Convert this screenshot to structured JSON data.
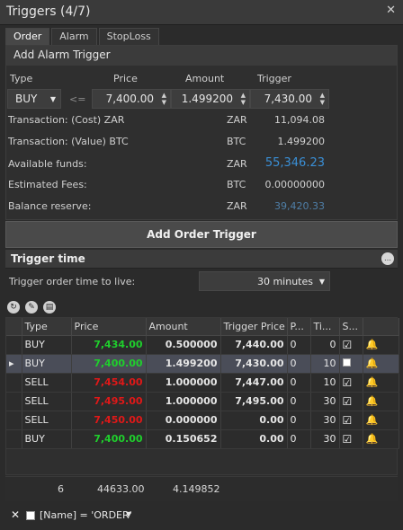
{
  "window": {
    "title": "Triggers (4/7)",
    "close_glyph": "✕"
  },
  "tabs": [
    {
      "label": "Order",
      "active": true
    },
    {
      "label": "Alarm",
      "active": false
    },
    {
      "label": "StopLoss",
      "active": false
    }
  ],
  "form": {
    "header": "Add Alarm Trigger",
    "labels": {
      "type": "Type",
      "price": "Price",
      "amount": "Amount",
      "trigger": "Trigger"
    },
    "type_value": "BUY",
    "operator": "<=",
    "price_value": "7,400.00",
    "amount_value": "1.499200",
    "trigger_value": "7,430.00",
    "rows": [
      {
        "label": "Transaction: (Cost) ZAR",
        "currency": "ZAR",
        "value": "11,094.08"
      },
      {
        "label": "Transaction: (Value) BTC",
        "currency": "BTC",
        "value": "1.499200"
      },
      {
        "label": "Available funds:",
        "currency": "ZAR",
        "value": "55,346.23"
      },
      {
        "label": "Estimated Fees:",
        "currency": "BTC",
        "value": "0.00000000"
      },
      {
        "label": "Balance reserve:",
        "currency": "ZAR",
        "value": "39,420.33"
      }
    ]
  },
  "add_button": "Add Order Trigger",
  "trigger_time": {
    "title": "Trigger time",
    "ttl_label": "Trigger order time to live:",
    "ttl_value": "30 minutes"
  },
  "grid": {
    "columns": [
      "Type",
      "Price",
      "Amount",
      "Trigger Price",
      "P...",
      "Ti...",
      "S..."
    ],
    "rows": [
      {
        "type": "BUY",
        "price": "7,434.00",
        "price_color": "green",
        "amount": "0.500000",
        "trigger": "7,440.00",
        "p": "0",
        "ti": "0",
        "checked": true,
        "bell": "green"
      },
      {
        "type": "BUY",
        "price": "7,400.00",
        "price_color": "green",
        "amount": "1.499200",
        "trigger": "7,430.00",
        "p": "0",
        "ti": "10",
        "checked": false,
        "bell": "blue",
        "selected": true
      },
      {
        "type": "SELL",
        "price": "7,454.00",
        "price_color": "red",
        "amount": "1.000000",
        "trigger": "7,447.00",
        "p": "0",
        "ti": "10",
        "checked": true,
        "bell": "red"
      },
      {
        "type": "SELL",
        "price": "7,495.00",
        "price_color": "red",
        "amount": "1.000000",
        "trigger": "7,495.00",
        "p": "0",
        "ti": "30",
        "checked": true,
        "bell": "red"
      },
      {
        "type": "SELL",
        "price": "7,450.00",
        "price_color": "red",
        "amount": "0.000000",
        "trigger": "0.00",
        "p": "0",
        "ti": "30",
        "checked": true,
        "bell": "yellow"
      },
      {
        "type": "BUY",
        "price": "7,400.00",
        "price_color": "green",
        "amount": "0.150652",
        "trigger": "0.00",
        "p": "0",
        "ti": "30",
        "checked": true,
        "bell": "yellow"
      }
    ]
  },
  "totals": {
    "count": "6",
    "price_sum": "44633.00",
    "amount_sum": "4.149852"
  },
  "filter": {
    "close": "✕",
    "expression": "[Name] = 'ORDER'"
  },
  "colors": {
    "green": "#1fcf2c",
    "red": "#e01818",
    "blue_value": "#3a8fd6",
    "dim_blue": "#4f7fa8"
  },
  "icons": {
    "refresh": "refresh-icon",
    "edit": "edit-icon",
    "delete": "delete-icon",
    "info": "info-icon"
  }
}
